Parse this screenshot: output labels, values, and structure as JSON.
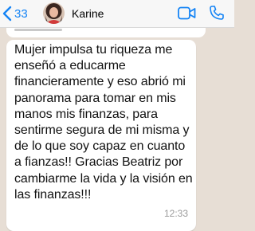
{
  "header": {
    "back_count": "33",
    "contact_name": "Karine",
    "icons": {
      "back": "chevron-left-icon",
      "video": "video-call-icon",
      "phone": "phone-icon"
    }
  },
  "message": {
    "text": "Mujer impulsa tu riqueza me enseñó a educarme financieramente y eso abrió mi panorama para tomar en mis manos mis finanzas, para sentirme segura de mi misma y de lo que soy capaz en cuanto a fianzas!! Gracias Beatriz por cambiarme la vida y la visión en las finanzas!!!",
    "time": "12:33"
  },
  "colors": {
    "accent": "#1584f5",
    "chat_background": "#e7ded5",
    "bubble": "#ffffff",
    "header_background": "#f7f7f7"
  }
}
